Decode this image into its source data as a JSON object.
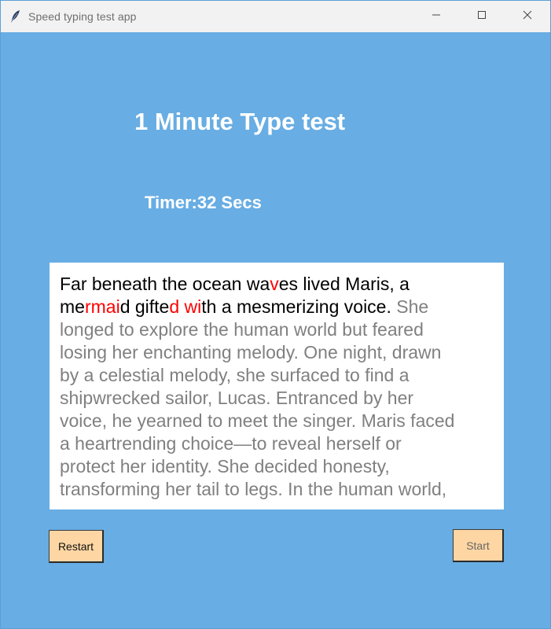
{
  "window": {
    "title": "Speed typing test app",
    "icon": "feather-icon",
    "controls": [
      "minimize-icon",
      "maximize-icon",
      "close-icon"
    ]
  },
  "header": {
    "title": "1 Minute Type test"
  },
  "timer": {
    "text": "Timer:32 Secs"
  },
  "passage": {
    "colors": {
      "typed": "#000000",
      "wrong": "#ff0000",
      "pending": "#808080"
    },
    "lines": [
      [
        {
          "t": "Far beneath the ocean wa",
          "s": "typed"
        },
        {
          "t": "v",
          "s": "wrong"
        },
        {
          "t": "es lived Maris, a",
          "s": "typed"
        }
      ],
      [
        {
          "t": "me",
          "s": "typed"
        },
        {
          "t": "rmai",
          "s": "wrong"
        },
        {
          "t": "d gifte",
          "s": "typed"
        },
        {
          "t": "d",
          "s": "wrong"
        },
        {
          "t": " ",
          "s": "typed"
        },
        {
          "t": "wi",
          "s": "wrong"
        },
        {
          "t": "th a mesmerizing voice.",
          "s": "typed"
        },
        {
          "t": " She",
          "s": "pending"
        }
      ],
      [
        {
          "t": "longed to explore the human world but feared",
          "s": "pending"
        }
      ],
      [
        {
          "t": "losing her enchanting melody. One night, drawn",
          "s": "pending"
        }
      ],
      [
        {
          "t": "by a celestial melody, she surfaced to find a",
          "s": "pending"
        }
      ],
      [
        {
          "t": "shipwrecked sailor, Lucas. Entranced by her",
          "s": "pending"
        }
      ],
      [
        {
          "t": "voice, he yearned to meet the singer. Maris faced",
          "s": "pending"
        }
      ],
      [
        {
          "t": "a heartrending choice—to reveal herself or",
          "s": "pending"
        }
      ],
      [
        {
          "t": "protect her identity. She decided honesty,",
          "s": "pending"
        }
      ],
      [
        {
          "t": "transforming her tail to legs. In the human world,",
          "s": "pending"
        }
      ]
    ]
  },
  "buttons": {
    "restart_label": "Restart",
    "start_label": "Start"
  }
}
